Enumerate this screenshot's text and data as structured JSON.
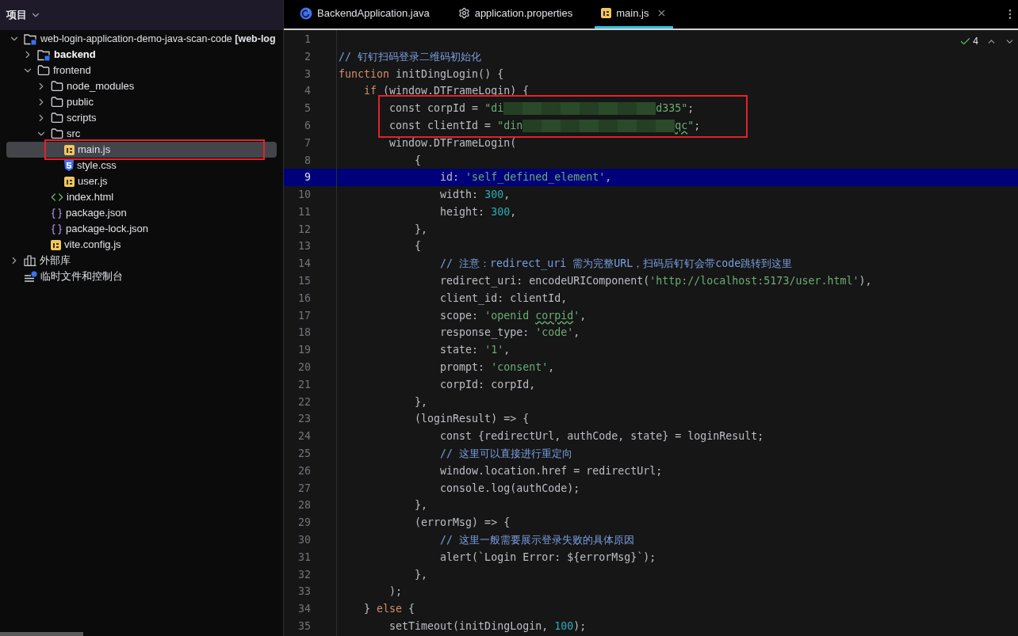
{
  "sidebar": {
    "title": "项目",
    "tree": [
      {
        "label": "web-login-application-demo-java-scan-code **[web-log**",
        "kind": "module",
        "expanded": true,
        "bold": false,
        "selected": false,
        "boxed": false,
        "children": [
          {
            "label": "backend",
            "kind": "module",
            "expanded": false,
            "bold": true,
            "selected": false,
            "boxed": false
          },
          {
            "label": "frontend",
            "kind": "folder",
            "expanded": true,
            "bold": false,
            "selected": false,
            "boxed": false,
            "children": [
              {
                "label": "node_modules",
                "kind": "folder",
                "expanded": false,
                "bold": false,
                "selected": false,
                "boxed": false
              },
              {
                "label": "public",
                "kind": "folder",
                "expanded": false,
                "bold": false,
                "selected": false,
                "boxed": false
              },
              {
                "label": "scripts",
                "kind": "folder",
                "expanded": false,
                "bold": false,
                "selected": false,
                "boxed": false
              },
              {
                "label": "src",
                "kind": "folder",
                "expanded": true,
                "bold": false,
                "selected": false,
                "boxed": false,
                "children": [
                  {
                    "label": "main.js",
                    "kind": "js",
                    "bold": false,
                    "selected": true,
                    "boxed": true
                  },
                  {
                    "label": "style.css",
                    "kind": "css",
                    "bold": false,
                    "selected": false,
                    "boxed": false
                  },
                  {
                    "label": "user.js",
                    "kind": "js",
                    "bold": false,
                    "selected": false,
                    "boxed": false
                  }
                ]
              },
              {
                "label": "index.html",
                "kind": "html",
                "bold": false,
                "selected": false,
                "boxed": false
              },
              {
                "label": "package.json",
                "kind": "json",
                "bold": false,
                "selected": false,
                "boxed": false
              },
              {
                "label": "package-lock.json",
                "kind": "json",
                "bold": false,
                "selected": false,
                "boxed": false
              },
              {
                "label": "vite.config.js",
                "kind": "js",
                "bold": false,
                "selected": false,
                "boxed": false
              }
            ]
          }
        ]
      },
      {
        "label": "外部库",
        "kind": "library",
        "expanded": false,
        "bold": false,
        "selected": false,
        "boxed": false
      },
      {
        "label": "临时文件和控制台",
        "kind": "scratches",
        "bold": false,
        "selected": false,
        "boxed": false
      }
    ]
  },
  "tabs": [
    {
      "label": "BackendApplication.java",
      "kind": "java",
      "selected": false,
      "closable": false
    },
    {
      "label": "application.properties",
      "kind": "properties",
      "selected": false,
      "closable": false
    },
    {
      "label": "main.js",
      "kind": "js",
      "selected": true,
      "closable": true
    }
  ],
  "inspection": {
    "count": "4"
  },
  "code": {
    "lines": [
      {
        "number": "1",
        "selected": false,
        "boxed": false
      },
      {
        "number": "2",
        "selected": false,
        "boxed": false,
        "tokens": [
          {
            "kind": "comment",
            "text": "// 钉钉扫码登录二维码初始化"
          }
        ]
      },
      {
        "number": "3",
        "selected": false,
        "boxed": false,
        "tokens": [
          {
            "kind": "keyword",
            "text": "function"
          },
          {
            "kind": "plain",
            "text": " initDingLogin() {"
          }
        ]
      },
      {
        "number": "4",
        "selected": false,
        "boxed": false,
        "tokens": [
          {
            "kind": "keyword",
            "text": "    if"
          },
          {
            "kind": "plain",
            "text": " (window.DTFrameLogin) {"
          }
        ]
      },
      {
        "number": "5",
        "selected": false,
        "boxed": true,
        "tokens": [
          {
            "kind": "plain",
            "text": "        const corpId = "
          },
          {
            "kind": "string",
            "text": "\"di"
          },
          {
            "kind": "redacted"
          },
          {
            "kind": "string",
            "text": "d335\""
          },
          {
            "kind": "plain",
            "text": ";"
          }
        ]
      },
      {
        "number": "6",
        "selected": false,
        "boxed": true,
        "tokens": [
          {
            "kind": "plain",
            "text": "        const clientId = "
          },
          {
            "kind": "string",
            "text": "\"din"
          },
          {
            "kind": "redacted"
          },
          {
            "kind": "string",
            "text": "qc",
            "typo": true
          },
          {
            "kind": "string",
            "text": "\""
          },
          {
            "kind": "plain",
            "text": ";"
          }
        ]
      },
      {
        "number": "7",
        "selected": false,
        "boxed": false,
        "tokens": [
          {
            "kind": "plain",
            "text": "        window.DTFrameLogin("
          }
        ]
      },
      {
        "number": "8",
        "selected": false,
        "boxed": false,
        "tokens": [
          {
            "kind": "plain",
            "text": "            {"
          }
        ]
      },
      {
        "number": "9",
        "selected": true,
        "boxed": false,
        "tokens": [
          {
            "kind": "plain",
            "text": "                id: "
          },
          {
            "kind": "string",
            "text": "'self_defined_element'"
          },
          {
            "kind": "plain",
            "text": ","
          }
        ]
      },
      {
        "number": "10",
        "selected": false,
        "boxed": false,
        "tokens": [
          {
            "kind": "plain",
            "text": "                width: "
          },
          {
            "kind": "number",
            "text": "300"
          },
          {
            "kind": "plain",
            "text": ","
          }
        ]
      },
      {
        "number": "11",
        "selected": false,
        "boxed": false,
        "tokens": [
          {
            "kind": "plain",
            "text": "                height: "
          },
          {
            "kind": "number",
            "text": "300"
          },
          {
            "kind": "plain",
            "text": ","
          }
        ]
      },
      {
        "number": "12",
        "selected": false,
        "boxed": false,
        "tokens": [
          {
            "kind": "plain",
            "text": "            },"
          }
        ]
      },
      {
        "number": "13",
        "selected": false,
        "boxed": false,
        "tokens": [
          {
            "kind": "plain",
            "text": "            {"
          }
        ]
      },
      {
        "number": "14",
        "selected": false,
        "boxed": false,
        "tokens": [
          {
            "kind": "comment",
            "text": "                // 注意：redirect_uri 需为完整URL，扫码后钉钉会带code跳转到这里"
          }
        ]
      },
      {
        "number": "15",
        "selected": false,
        "boxed": false,
        "tokens": [
          {
            "kind": "plain",
            "text": "                redirect_uri: encodeURIComponent("
          },
          {
            "kind": "string",
            "text": "'http://localhost:5173/user.html'"
          },
          {
            "kind": "plain",
            "text": "),"
          }
        ]
      },
      {
        "number": "16",
        "selected": false,
        "boxed": false,
        "tokens": [
          {
            "kind": "plain",
            "text": "                client_id: clientId,"
          }
        ]
      },
      {
        "number": "17",
        "selected": false,
        "boxed": false,
        "tokens": [
          {
            "kind": "plain",
            "text": "                scope: "
          },
          {
            "kind": "string",
            "text": "'openid "
          },
          {
            "kind": "string",
            "text": "corpid",
            "typo": true
          },
          {
            "kind": "string",
            "text": "'"
          },
          {
            "kind": "plain",
            "text": ","
          }
        ]
      },
      {
        "number": "18",
        "selected": false,
        "boxed": false,
        "tokens": [
          {
            "kind": "plain",
            "text": "                response_type: "
          },
          {
            "kind": "string",
            "text": "'code'"
          },
          {
            "kind": "plain",
            "text": ","
          }
        ]
      },
      {
        "number": "19",
        "selected": false,
        "boxed": false,
        "tokens": [
          {
            "kind": "plain",
            "text": "                state: "
          },
          {
            "kind": "string",
            "text": "'1'"
          },
          {
            "kind": "plain",
            "text": ","
          }
        ]
      },
      {
        "number": "20",
        "selected": false,
        "boxed": false,
        "tokens": [
          {
            "kind": "plain",
            "text": "                prompt: "
          },
          {
            "kind": "string",
            "text": "'consent'"
          },
          {
            "kind": "plain",
            "text": ","
          }
        ]
      },
      {
        "number": "21",
        "selected": false,
        "boxed": false,
        "tokens": [
          {
            "kind": "plain",
            "text": "                corpId: corpId,"
          }
        ]
      },
      {
        "number": "22",
        "selected": false,
        "boxed": false,
        "tokens": [
          {
            "kind": "plain",
            "text": "            },"
          }
        ]
      },
      {
        "number": "23",
        "selected": false,
        "boxed": false,
        "tokens": [
          {
            "kind": "plain",
            "text": "            (loginResult) => {"
          }
        ]
      },
      {
        "number": "24",
        "selected": false,
        "boxed": false,
        "tokens": [
          {
            "kind": "plain",
            "text": "                const {redirectUrl, authCode, state} = loginResult;"
          }
        ]
      },
      {
        "number": "25",
        "selected": false,
        "boxed": false,
        "tokens": [
          {
            "kind": "comment",
            "text": "                // 这里可以直接进行重定向"
          }
        ]
      },
      {
        "number": "26",
        "selected": false,
        "boxed": false,
        "tokens": [
          {
            "kind": "plain",
            "text": "                window.location.href = redirectUrl;"
          }
        ]
      },
      {
        "number": "27",
        "selected": false,
        "boxed": false,
        "tokens": [
          {
            "kind": "plain",
            "text": "                console.log(authCode);"
          }
        ]
      },
      {
        "number": "28",
        "selected": false,
        "boxed": false,
        "tokens": [
          {
            "kind": "plain",
            "text": "            },"
          }
        ]
      },
      {
        "number": "29",
        "selected": false,
        "boxed": false,
        "tokens": [
          {
            "kind": "plain",
            "text": "            (errorMsg) => {"
          }
        ]
      },
      {
        "number": "30",
        "selected": false,
        "boxed": false,
        "tokens": [
          {
            "kind": "comment",
            "text": "                // 这里一般需要展示登录失败的具体原因"
          }
        ]
      },
      {
        "number": "31",
        "selected": false,
        "boxed": false,
        "tokens": [
          {
            "kind": "plain",
            "text": "                alert(`Login Error: ${errorMsg}`);"
          }
        ]
      },
      {
        "number": "32",
        "selected": false,
        "boxed": false,
        "tokens": [
          {
            "kind": "plain",
            "text": "            },"
          }
        ]
      },
      {
        "number": "33",
        "selected": false,
        "boxed": false,
        "tokens": [
          {
            "kind": "plain",
            "text": "        );"
          }
        ]
      },
      {
        "number": "34",
        "selected": false,
        "boxed": false,
        "tokens": [
          {
            "kind": "plain",
            "text": "    } "
          },
          {
            "kind": "keyword",
            "text": "else"
          },
          {
            "kind": "plain",
            "text": " {"
          }
        ]
      },
      {
        "number": "35",
        "selected": false,
        "boxed": false,
        "tokens": [
          {
            "kind": "plain",
            "text": "        setTimeout(initDingLogin, "
          },
          {
            "kind": "number",
            "text": "100"
          },
          {
            "kind": "plain",
            "text": ");"
          }
        ]
      }
    ]
  }
}
